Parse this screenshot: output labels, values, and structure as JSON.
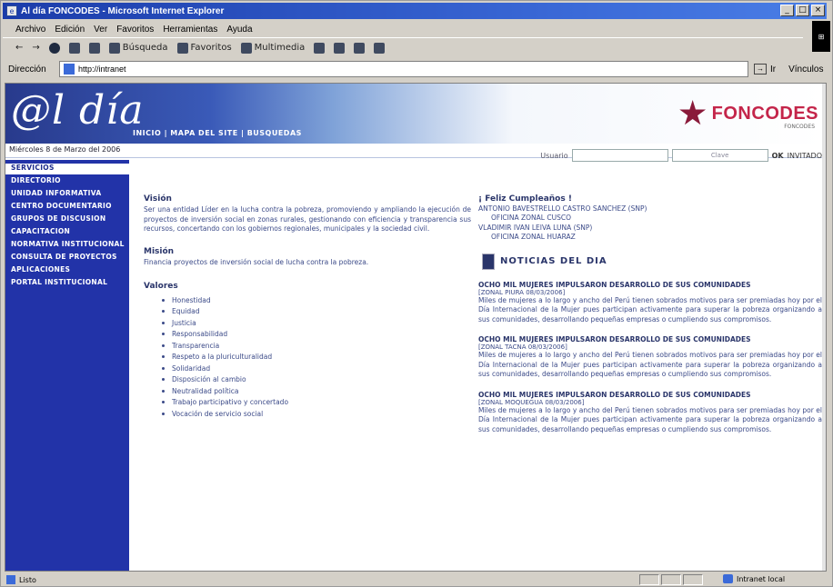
{
  "window": {
    "title": "Al día FONCODES - Microsoft Internet Explorer",
    "controls": [
      "_",
      "□",
      "×"
    ]
  },
  "menu": [
    "Archivo",
    "Edición",
    "Ver",
    "Favoritos",
    "Herramientas",
    "Ayuda"
  ],
  "toolbar": {
    "back": "←",
    "forward": "→",
    "search": "Búsqueda",
    "favorites": "Favoritos",
    "history": "Multimedia"
  },
  "address": {
    "label": "Dirección",
    "url": "http://intranet",
    "go": "Ir",
    "links": "Vínculos"
  },
  "site": {
    "logo": "@l día",
    "nav": "INICIO | MAPA DEL SITE | BUSQUEDAS",
    "brand": "FONCODES",
    "brand_sub": "FONCODES",
    "date": "Miércoles 8 de Marzo del 2006",
    "login_user": "Usuario",
    "login_pass": "Clave",
    "ok": "OK",
    "invitado": "INVITADO"
  },
  "sidebar": [
    "SERVICIOS",
    "DIRECTORIO",
    "UNIDAD INFORMATIVA",
    "CENTRO DOCUMENTARIO",
    "GRUPOS DE DISCUSION",
    "CAPACITACION",
    "NORMATIVA INSTITUCIONAL",
    "CONSULTA DE PROYECTOS",
    "APLICACIONES",
    "PORTAL INSTITUCIONAL"
  ],
  "vision": {
    "title": "Visión",
    "text": "Ser una entidad Líder en la lucha contra la pobreza, promoviendo y ampliando la ejecución de proyectos de inversión social en zonas rurales, gestionando con eficiencia y transparencia sus recursos, concertando con los gobiernos regionales, municipales y la sociedad civil."
  },
  "mision": {
    "title": "Misión",
    "text": "Financia proyectos de inversión social de lucha contra la pobreza."
  },
  "valores": {
    "title": "Valores",
    "items": [
      "Honestidad",
      "Equidad",
      "Justicia",
      "Responsabilidad",
      "Transparencia",
      "Respeto a la pluriculturalidad",
      "Solidaridad",
      "Disposición al cambio",
      "Neutralidad política",
      "Trabajo participativo y concertado",
      "Vocación de servicio social"
    ]
  },
  "birthdays": {
    "title": "¡ Feliz Cumpleaños !",
    "entries": [
      {
        "name": "ANTONIO BAVESTRELLO CASTRO SANCHEZ (SNP)",
        "office": "OFICINA ZONAL CUSCO"
      },
      {
        "name": "VLADIMIR IVAN LEIVA LUNA (SNP)",
        "office": "OFICINA ZONAL HUARAZ"
      }
    ]
  },
  "news_title": "NOTICIAS DEL DIA",
  "news": [
    {
      "headline": "OCHO MIL MUJERES IMPULSARON DESARROLLO DE SUS COMUNIDADES",
      "date": "[ZONAL PIURA 08/03/2006]",
      "body": "Miles de mujeres a lo largo y ancho del Perú tienen sobrados motivos para ser premiadas hoy por el Día Internacional de la Mujer pues participan activamente para superar la pobreza organizando a sus comunidades, desarrollando pequeñas empresas o cumpliendo sus compromisos."
    },
    {
      "headline": "OCHO MIL MUJERES IMPULSARON DESARROLLO DE SUS COMUNIDADES",
      "date": "[ZONAL TACNA 08/03/2006]",
      "body": "Miles de mujeres a lo largo y ancho del Perú tienen sobrados motivos para ser premiadas hoy por el Día Internacional de la Mujer pues participan activamente para superar la pobreza organizando a sus comunidades, desarrollando pequeñas empresas o cumpliendo sus compromisos."
    },
    {
      "headline": "OCHO MIL MUJERES IMPULSARON DESARROLLO DE SUS COMUNIDADES",
      "date": "[ZONAL MOQUEGUA 08/03/2006]",
      "body": "Miles de mujeres a lo largo y ancho del Perú tienen sobrados motivos para ser premiadas hoy por el Día Internacional de la Mujer pues participan activamente para superar la pobreza organizando a sus comunidades, desarrollando pequeñas empresas o cumpliendo sus compromisos."
    }
  ],
  "status": {
    "left": "Listo",
    "zone": "Intranet local"
  },
  "colors": {
    "accent": "#2233a8",
    "brand": "#c4254a",
    "title_bar": "#1b3caa"
  }
}
